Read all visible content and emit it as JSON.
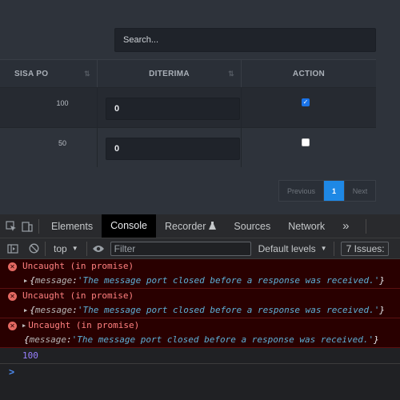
{
  "app": {
    "search": {
      "placeholder": "Search..."
    },
    "table": {
      "headers": [
        "SISA PO",
        "DITERIMA",
        "ACTION"
      ],
      "sort_icon": "⇅",
      "rows": [
        {
          "sisa_po": "100",
          "diterima": "0",
          "checked": true
        },
        {
          "sisa_po": "50",
          "diterima": "0",
          "checked": false
        }
      ]
    },
    "pagination": {
      "previous": "Previous",
      "current": "1",
      "next": "Next"
    }
  },
  "devtools": {
    "tabs": [
      "Elements",
      "Console",
      "Recorder",
      "Sources",
      "Network"
    ],
    "active_tab": "Console",
    "recorder_icon": "flask-icon",
    "more_tabs": "»",
    "toolbar": {
      "context": "top",
      "filter_placeholder": "Filter",
      "levels": "Default levels",
      "issues": "7 Issues:"
    },
    "messages": [
      {
        "title": "Uncaught (in promise)",
        "key": "message",
        "value": "'The message port closed before a response was received.'"
      },
      {
        "title": "Uncaught (in promise)",
        "key": "message",
        "value": "'The message port closed before a response was received.'"
      },
      {
        "title": "Uncaught (in promise)",
        "key": "message",
        "value": "'The message port closed before a response was received.'"
      }
    ],
    "output": "100",
    "prompt": ">"
  }
}
